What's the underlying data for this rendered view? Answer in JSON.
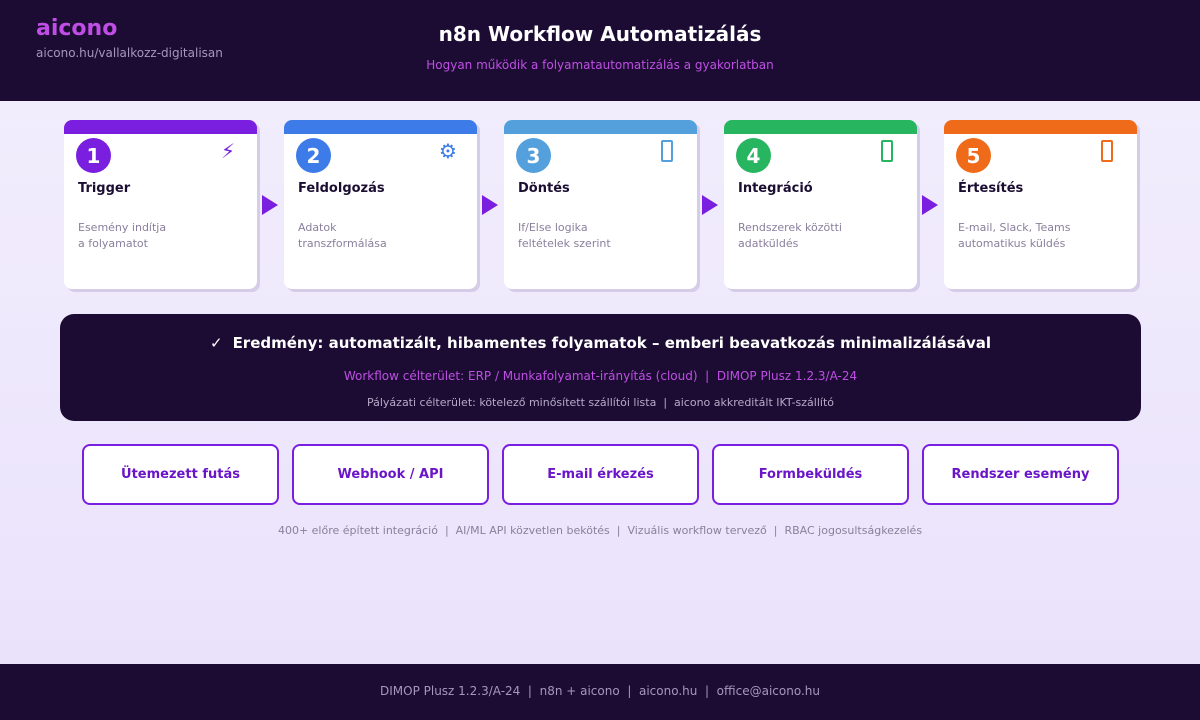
{
  "header": {
    "brand": "aicono",
    "brand_url": "aicono.hu/vallalkozz-digitalisan",
    "title": "n8n Workflow Automatizálás",
    "subtitle": "Hogyan működik a folyamatautomatizálás a gyakorlatban"
  },
  "steps": [
    {
      "num": "1",
      "title": "Trigger",
      "desc1": "Esemény indítja",
      "desc2": "a folyamatot",
      "color": "#7a1fe0",
      "icon": "lightning-icon",
      "glyph": "⚡"
    },
    {
      "num": "2",
      "title": "Feldolgozás",
      "desc1": "Adatok",
      "desc2": "transzformálása",
      "color": "#3d7be8",
      "icon": "gear-icon",
      "glyph": "⚙"
    },
    {
      "num": "3",
      "title": "Döntés",
      "desc1": "If/Else logika",
      "desc2": "feltételek szerint",
      "color": "#54a0dc",
      "icon": "decision-icon",
      "glyph": ""
    },
    {
      "num": "4",
      "title": "Integráció",
      "desc1": "Rendszerek közötti",
      "desc2": "adatküldés",
      "color": "#27b560",
      "icon": "integration-icon",
      "glyph": ""
    },
    {
      "num": "5",
      "title": "Értesítés",
      "desc1": "E-mail, Slack, Teams",
      "desc2": "automatikus küldés",
      "color": "#ef6b1a",
      "icon": "notification-icon",
      "glyph": ""
    }
  ],
  "result": {
    "check": "✓",
    "main": "Eredmény: automatizált, hibamentes folyamatok – emberi beavatkozás minimalizálásával",
    "line2": "Workflow célterület: ERP / Munkafolyamat-irányítás (cloud)  |  DIMOP Plusz 1.2.3/A-24",
    "line3": "Pályázati célterület: kötelező minősített szállítói lista  |  aicono akkreditált IKT-szállító"
  },
  "triggers": [
    "Ütemezett futás",
    "Webhook / API",
    "E-mail érkezés",
    "Formbeküldés",
    "Rendszer esemény"
  ],
  "features": "400+ előre épített integráció  |  AI/ML API közvetlen bekötés  |  Vizuális workflow tervező  |  RBAC jogosultságkezelés",
  "footer": "DIMOP Plusz 1.2.3/A-24  |  n8n + aicono  |  aicono.hu  |  office@aicono.hu",
  "colors": {
    "dark": "#1c0c33",
    "accent": "#c04ee6",
    "purple": "#7a1fe0"
  }
}
